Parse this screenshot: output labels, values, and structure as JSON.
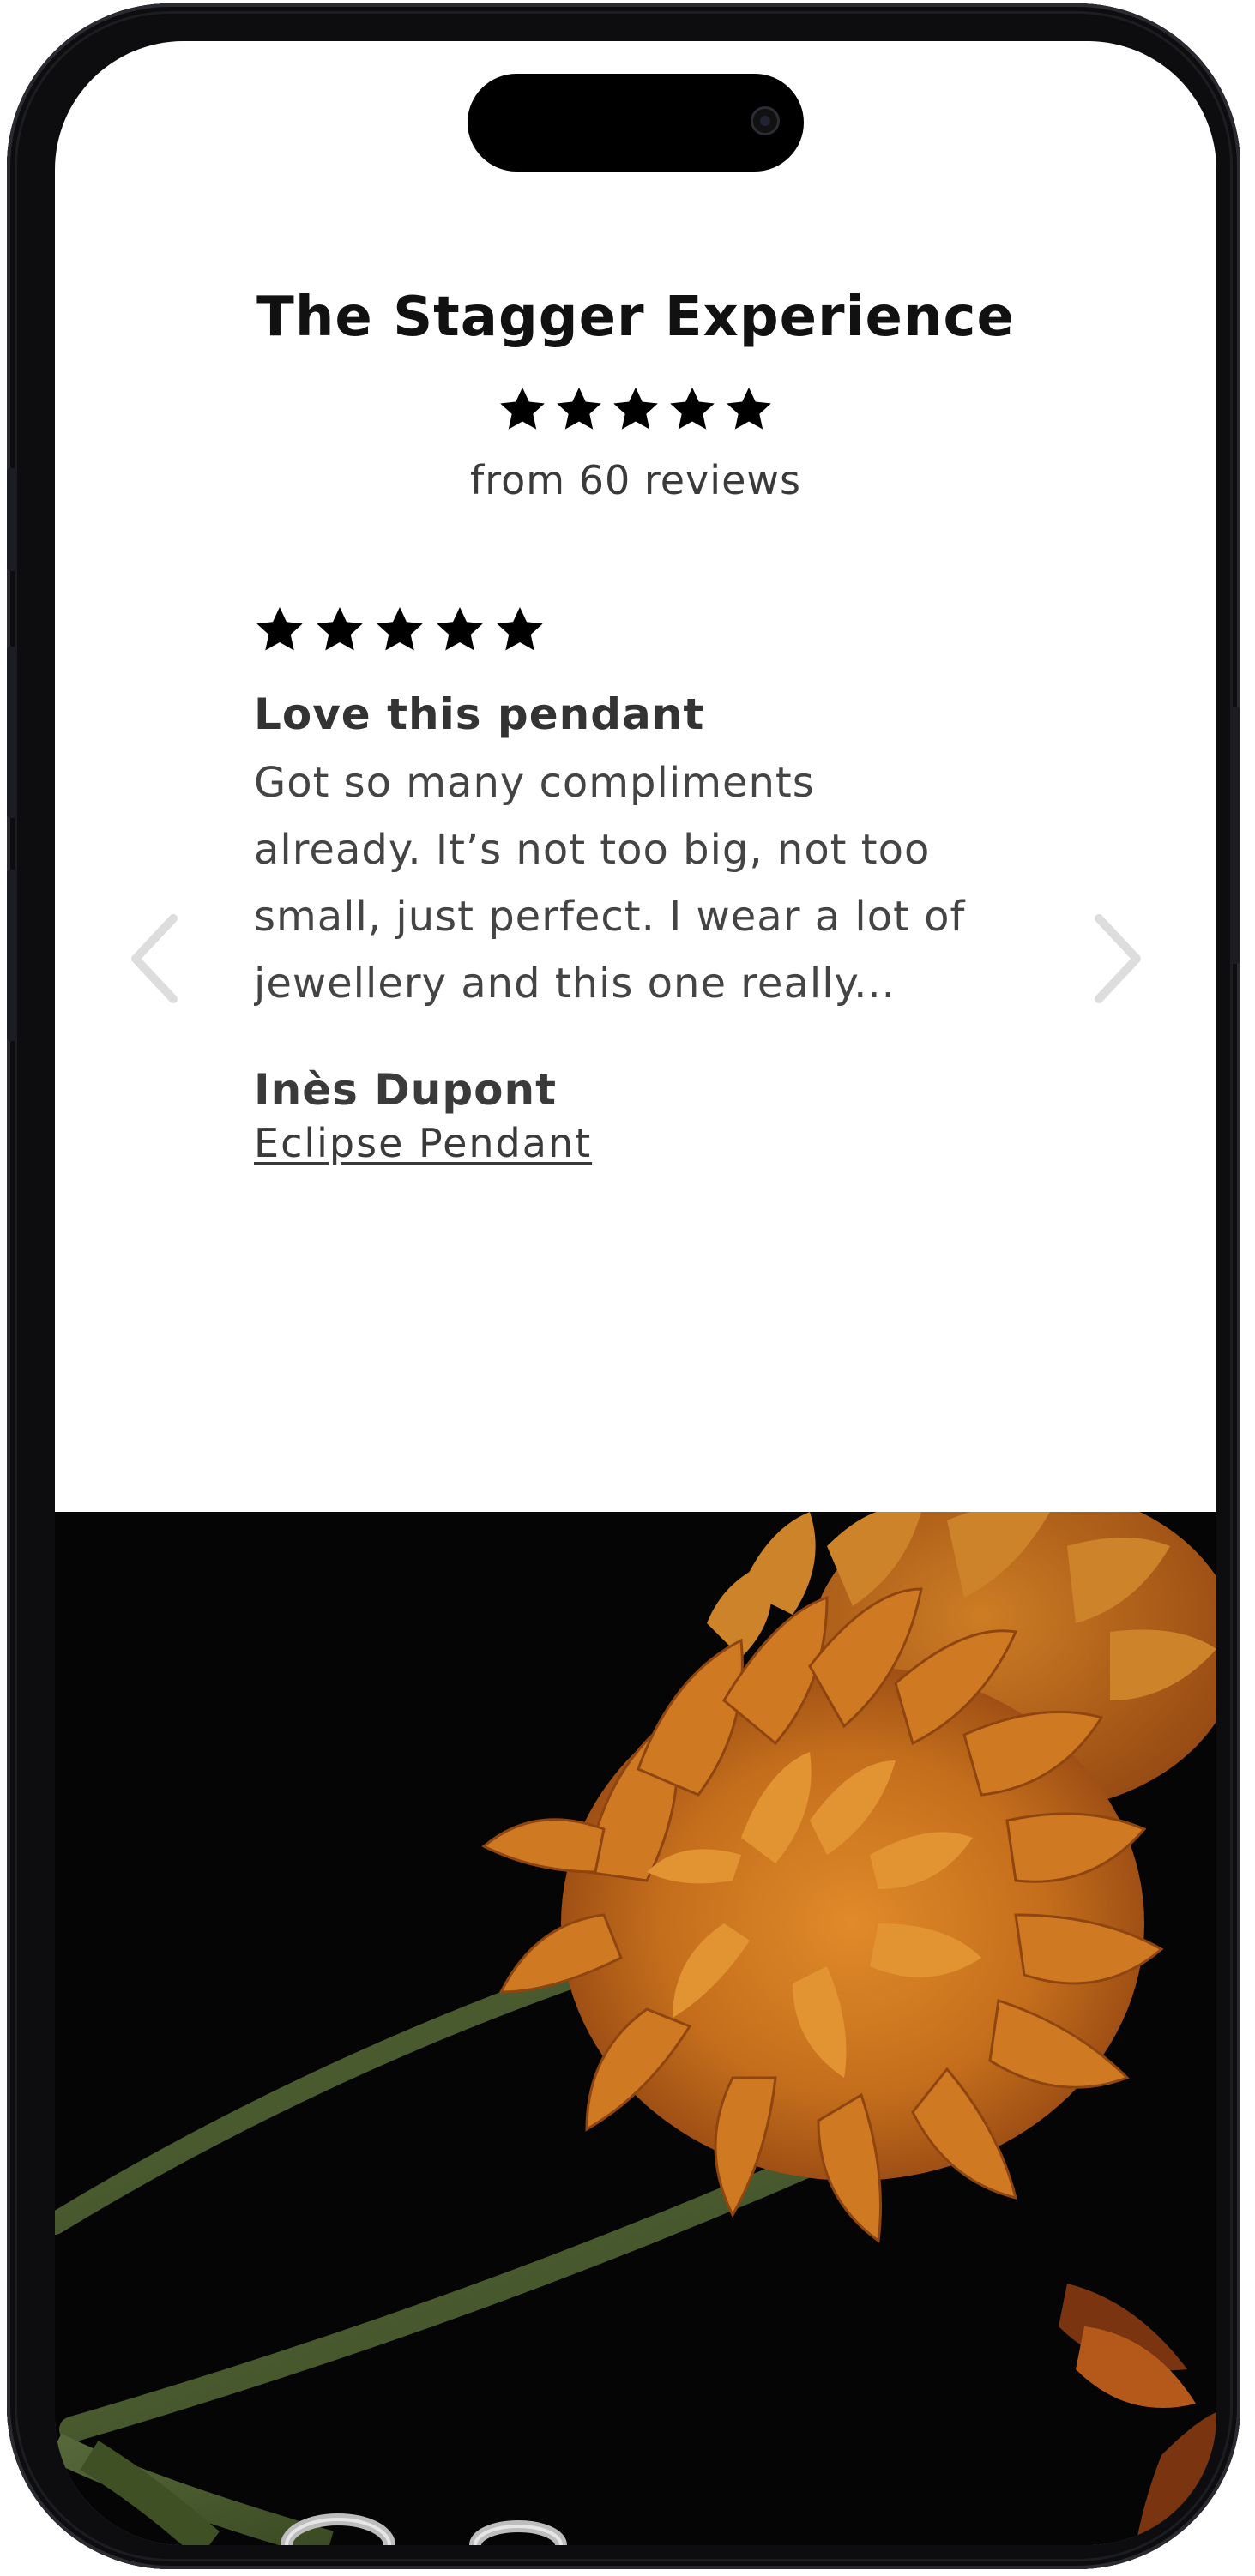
{
  "reviews_widget": {
    "title": "The Stagger Experience",
    "average_rating": 5,
    "max_rating": 5,
    "review_count_text": "from 60 reviews"
  },
  "review": {
    "rating": 5,
    "heading": "Love this pendant",
    "body": "Got so many compliments already. It’s not too big, not too small, just perfect. I wear a lot of jewellery and this one really...",
    "author": "Inès Dupont",
    "product_link": "Eclipse Pendant"
  },
  "carousel": {
    "prev_icon": "chevron-left-icon",
    "next_icon": "chevron-right-icon"
  },
  "hero": {
    "image_subject": "orange chrysanthemum flowers on black background",
    "colors": {
      "background": "#050505",
      "petal": "#c8731c",
      "stem": "#4a5a2a"
    }
  },
  "colors": {
    "text_primary": "#111111",
    "text_secondary": "#444444",
    "arrow": "#dddddd"
  }
}
